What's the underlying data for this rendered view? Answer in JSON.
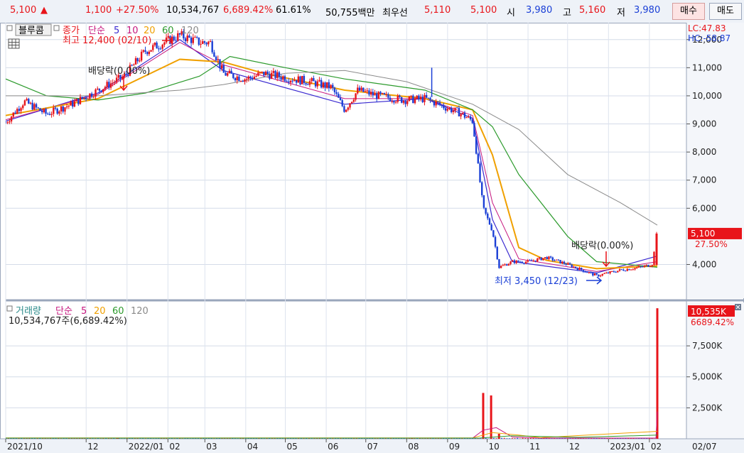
{
  "ticker": {
    "price": "5,100",
    "up_arrow": "▲",
    "change": "1,100",
    "change_pct": "+27.50%",
    "volume": "10,534,767",
    "volume_pct": "6,689.42%",
    "turnover_ratio": "61.61%",
    "amount": "50,755백만",
    "best_label": "최우선",
    "best_ask": "5,110",
    "best_bid": "5,100",
    "open_label": "시",
    "open": "3,980",
    "high_label": "고",
    "high": "5,160",
    "low_label": "저",
    "low": "3,980",
    "buy_label": "매수",
    "sell_label": "매도"
  },
  "price_panel": {
    "stock_name": "블루콤",
    "ma_legend": {
      "price_label": "종가",
      "type_label": "단순",
      "periods": [
        "5",
        "10",
        "20",
        "60",
        "120"
      ]
    },
    "lc": "LC:47.83",
    "hc": "HC:-58.87",
    "annotations": {
      "high": "최고 12,400 (02/10)",
      "low": "최저 3,450 (12/23)",
      "ex_div1": "배당락(0.00%)",
      "ex_div2": "배당락(0.00%)"
    },
    "last_price_tag": "5,100",
    "last_pct_tag": "27.50%",
    "y_ticks": [
      "12,000",
      "11,000",
      "10,000",
      "9,000",
      "8,000",
      "7,000",
      "6,000",
      "4,000"
    ]
  },
  "volume_panel": {
    "title": "거래량",
    "type_label": "단순",
    "periods": [
      "5",
      "20",
      "60",
      "120"
    ],
    "info": "10,534,767주(6,689.42%)",
    "last_tag": "10,535K",
    "last_pct": "6689.42%",
    "y_ticks": [
      "7,500K",
      "5,000K",
      "2,500K"
    ]
  },
  "x_axis": {
    "labels": [
      "2021/10",
      "12",
      "2022/01",
      "02",
      "03",
      "04",
      "05",
      "06",
      "07",
      "08",
      "09",
      "10",
      "11",
      "12",
      "2023/01",
      "02",
      "02/07"
    ]
  },
  "colors": {
    "up": "#e8141a",
    "down": "#1a3fd6",
    "ma5": "#3a2ad0",
    "ma10": "#c6167e",
    "ma20": "#f0a000",
    "ma60": "#2c9a2c",
    "ma120": "#8a8a8a"
  },
  "chart_data": {
    "type": "line",
    "title": "블루콤",
    "series": [
      {
        "name": "종가",
        "points": [
          [
            "2021-10-01",
            9050
          ],
          [
            "2021-10-15",
            9800
          ],
          [
            "2021-11-01",
            9350
          ],
          [
            "2021-11-20",
            9700
          ],
          [
            "2021-12-10",
            10200
          ],
          [
            "2021-12-30",
            10700
          ],
          [
            "2022-01-15",
            11600
          ],
          [
            "2022-02-10",
            12150
          ],
          [
            "2022-02-25",
            11900
          ],
          [
            "2022-03-05",
            11900
          ],
          [
            "2022-03-15",
            10800
          ],
          [
            "2022-04-01",
            10600
          ],
          [
            "2022-04-15",
            10800
          ],
          [
            "2022-05-01",
            10650
          ],
          [
            "2022-05-20",
            10500
          ],
          [
            "2022-06-05",
            10300
          ],
          [
            "2022-06-15",
            9500
          ],
          [
            "2022-06-25",
            10200
          ],
          [
            "2022-07-10",
            10000
          ],
          [
            "2022-07-30",
            9850
          ],
          [
            "2022-08-15",
            9900
          ],
          [
            "2022-08-30",
            9600
          ],
          [
            "2022-09-10",
            9400
          ],
          [
            "2022-09-20",
            9100
          ],
          [
            "2022-09-28",
            6000
          ],
          [
            "2022-10-05",
            5200
          ],
          [
            "2022-10-10",
            3900
          ],
          [
            "2022-10-20",
            4100
          ],
          [
            "2022-11-01",
            4100
          ],
          [
            "2022-11-15",
            4250
          ],
          [
            "2022-12-01",
            4000
          ],
          [
            "2022-12-23",
            3600
          ],
          [
            "2023-01-10",
            3800
          ],
          [
            "2023-01-25",
            3900
          ],
          [
            "2023-02-03",
            4000
          ],
          [
            "2023-02-07",
            5100
          ]
        ]
      },
      {
        "name": "5",
        "points": [
          [
            "2021-10-01",
            9100
          ],
          [
            "2021-12-10",
            10100
          ],
          [
            "2022-02-10",
            12000
          ],
          [
            "2022-03-15",
            10900
          ],
          [
            "2022-06-15",
            9700
          ],
          [
            "2022-08-15",
            9900
          ],
          [
            "2022-09-20",
            9200
          ],
          [
            "2022-10-05",
            5600
          ],
          [
            "2022-10-20",
            4100
          ],
          [
            "2022-12-23",
            3700
          ],
          [
            "2023-02-07",
            4300
          ]
        ]
      },
      {
        "name": "10",
        "points": [
          [
            "2021-10-01",
            9150
          ],
          [
            "2021-12-10",
            10050
          ],
          [
            "2022-02-10",
            11900
          ],
          [
            "2022-03-15",
            11100
          ],
          [
            "2022-06-15",
            9900
          ],
          [
            "2022-08-15",
            9900
          ],
          [
            "2022-09-20",
            9300
          ],
          [
            "2022-10-05",
            6200
          ],
          [
            "2022-10-25",
            4200
          ],
          [
            "2022-12-23",
            3750
          ],
          [
            "2023-02-07",
            4100
          ]
        ]
      },
      {
        "name": "20",
        "points": [
          [
            "2021-10-01",
            9300
          ],
          [
            "2021-12-10",
            9900
          ],
          [
            "2022-02-10",
            11300
          ],
          [
            "2022-03-15",
            11200
          ],
          [
            "2022-04-15",
            10800
          ],
          [
            "2022-06-15",
            10200
          ],
          [
            "2022-08-15",
            9900
          ],
          [
            "2022-09-20",
            9500
          ],
          [
            "2022-10-05",
            7900
          ],
          [
            "2022-10-25",
            4600
          ],
          [
            "2022-11-15",
            4150
          ],
          [
            "2022-12-23",
            3850
          ],
          [
            "2023-02-07",
            3950
          ]
        ]
      },
      {
        "name": "60",
        "points": [
          [
            "2021-10-01",
            10600
          ],
          [
            "2021-11-01",
            10000
          ],
          [
            "2021-12-10",
            9850
          ],
          [
            "2022-01-15",
            10100
          ],
          [
            "2022-02-25",
            10700
          ],
          [
            "2022-03-20",
            11400
          ],
          [
            "2022-05-01",
            11000
          ],
          [
            "2022-06-15",
            10600
          ],
          [
            "2022-08-15",
            10200
          ],
          [
            "2022-09-20",
            9500
          ],
          [
            "2022-10-05",
            8900
          ],
          [
            "2022-10-25",
            7200
          ],
          [
            "2022-12-01",
            5000
          ],
          [
            "2022-12-23",
            4100
          ],
          [
            "2023-02-07",
            3900
          ]
        ]
      },
      {
        "name": "120",
        "points": [
          [
            "2021-10-01",
            10000
          ],
          [
            "2021-12-10",
            10000
          ],
          [
            "2022-02-10",
            10200
          ],
          [
            "2022-03-15",
            10400
          ],
          [
            "2022-05-01",
            10800
          ],
          [
            "2022-06-15",
            10900
          ],
          [
            "2022-08-01",
            10500
          ],
          [
            "2022-09-20",
            9700
          ],
          [
            "2022-10-25",
            8800
          ],
          [
            "2022-12-01",
            7200
          ],
          [
            "2023-01-10",
            6200
          ],
          [
            "2023-02-07",
            5400
          ]
        ]
      }
    ],
    "volume": {
      "name": "거래량",
      "unit": "K",
      "bars": [
        [
          "2021-12-25",
          80
        ],
        [
          "2022-08-05",
          80
        ],
        [
          "2022-09-28",
          3700
        ],
        [
          "2022-10-04",
          3500
        ],
        [
          "2022-10-10",
          400
        ],
        [
          "2023-02-07",
          10535
        ]
      ],
      "baseline_max": 80
    },
    "xlim": [
      "2021-10-01",
      "2023-02-07"
    ],
    "ylim": [
      2800,
      12600
    ],
    "volume_ylim": [
      0,
      11000
    ],
    "grid": true,
    "legend": "top-left"
  }
}
